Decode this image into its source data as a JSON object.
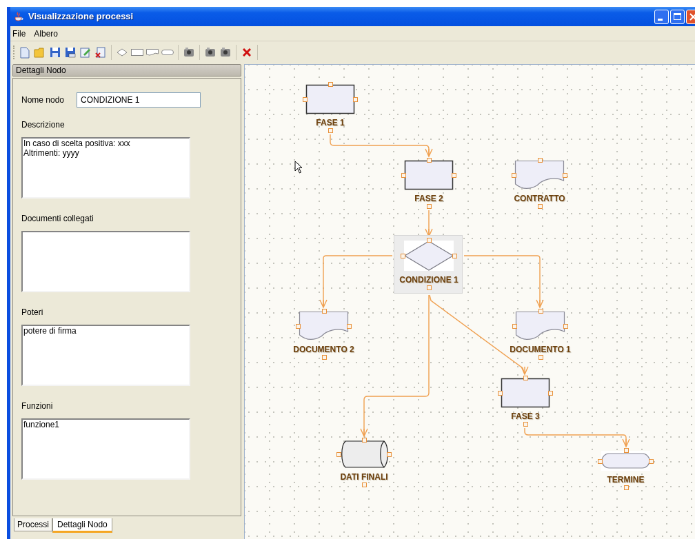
{
  "window": {
    "title": "Visualizzazione processi"
  },
  "menu": [
    "File",
    "Albero"
  ],
  "panel": {
    "title": "Dettagli Nodo",
    "name_label": "Nome nodo",
    "name_value": "CONDIZIONE 1",
    "fields": [
      {
        "label": "Descrizione",
        "value": "In caso di scelta positiva: xxx\nAltrimenti: yyyy"
      },
      {
        "label": "Documenti collegati"
      },
      {
        "label": "Poteri",
        "value": "potere di firma"
      },
      {
        "label": "Funzioni",
        "value": "funzione1"
      }
    ]
  },
  "tabs": [
    {
      "label": "Processi",
      "selected": false
    },
    {
      "label": "Dettagli Nodo",
      "selected": true
    }
  ],
  "diagram": {
    "nodes": [
      {
        "label": "FASE 1",
        "kind": "process",
        "selected": false
      },
      {
        "label": "FASE 2",
        "kind": "process",
        "selected": false
      },
      {
        "label": "CONTRATTO",
        "kind": "document",
        "selected": false
      },
      {
        "label": "CONDIZIONE 1",
        "kind": "decision",
        "selected": true
      },
      {
        "label": "DOCUMENTO 2",
        "kind": "document",
        "selected": false
      },
      {
        "label": "DOCUMENTO 1",
        "kind": "document",
        "selected": false
      },
      {
        "label": "FASE 3",
        "kind": "process",
        "selected": false
      },
      {
        "label": "DATI FINALI",
        "kind": "data",
        "selected": false
      },
      {
        "label": "TERMINE",
        "kind": "terminal",
        "selected": false
      }
    ]
  }
}
